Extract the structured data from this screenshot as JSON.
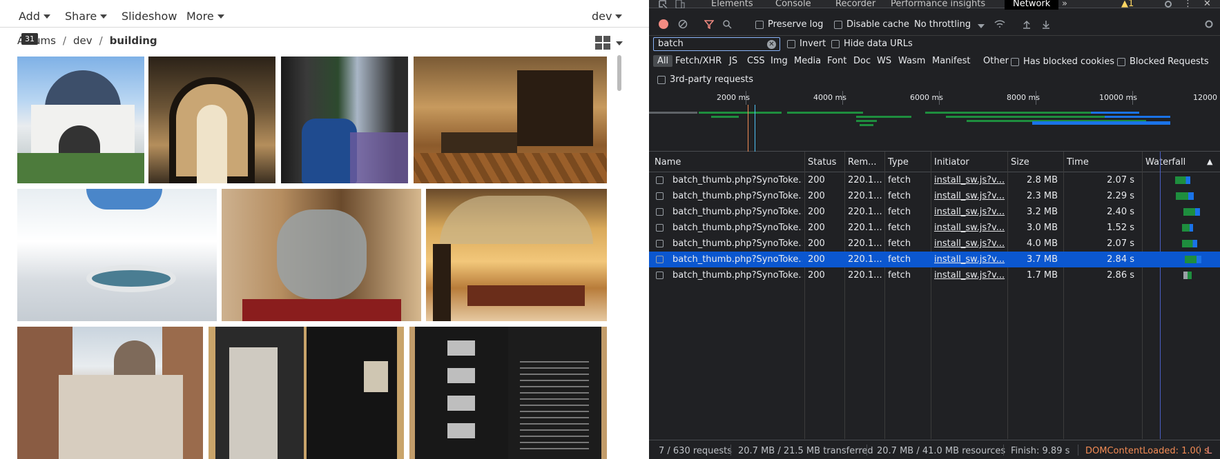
{
  "gallery": {
    "menus": [
      "Add",
      "Share",
      "Slideshow",
      "More"
    ],
    "user": "dev",
    "breadcrumb": [
      "Albums",
      "dev",
      "building"
    ],
    "tooltip": "31"
  },
  "devtools": {
    "tabs": [
      "Elements",
      "Console",
      "Recorder",
      "Performance insights",
      "Network"
    ],
    "active_tab": "Network",
    "warning_count": "1",
    "toolbar": {
      "preserve_log": "Preserve log",
      "disable_cache": "Disable cache",
      "throttling": "No throttling"
    },
    "filter": {
      "value": "batch",
      "invert": "Invert",
      "hide_data_urls": "Hide data URLs"
    },
    "types": [
      "All",
      "Fetch/XHR",
      "JS",
      "CSS",
      "Img",
      "Media",
      "Font",
      "Doc",
      "WS",
      "Wasm",
      "Manifest",
      "Other"
    ],
    "has_blocked_cookies": "Has blocked cookies",
    "blocked_requests": "Blocked Requests",
    "third_party": "3rd-party requests",
    "overview_ticks": [
      "2000 ms",
      "4000 ms",
      "6000 ms",
      "8000 ms",
      "10000 ms",
      "12000"
    ],
    "columns": [
      "Name",
      "Status",
      "Rem...",
      "Type",
      "Initiator",
      "Size",
      "Time",
      "Waterfall"
    ],
    "rows": [
      {
        "name": "batch_thumb.php?SynoToke...",
        "status": "200",
        "remote": "220.1...",
        "type": "fetch",
        "initiator": "install_sw.js?v...",
        "size": "2.8 MB",
        "time": "2.07 s"
      },
      {
        "name": "batch_thumb.php?SynoToke...",
        "status": "200",
        "remote": "220.1...",
        "type": "fetch",
        "initiator": "install_sw.js?v...",
        "size": "2.3 MB",
        "time": "2.29 s"
      },
      {
        "name": "batch_thumb.php?SynoToke...",
        "status": "200",
        "remote": "220.1...",
        "type": "fetch",
        "initiator": "install_sw.js?v...",
        "size": "3.2 MB",
        "time": "2.40 s"
      },
      {
        "name": "batch_thumb.php?SynoToke...",
        "status": "200",
        "remote": "220.1...",
        "type": "fetch",
        "initiator": "install_sw.js?v...",
        "size": "3.0 MB",
        "time": "1.52 s"
      },
      {
        "name": "batch_thumb.php?SynoToke...",
        "status": "200",
        "remote": "220.1...",
        "type": "fetch",
        "initiator": "install_sw.js?v...",
        "size": "4.0 MB",
        "time": "2.07 s"
      },
      {
        "name": "batch_thumb.php?SynoToke...",
        "status": "200",
        "remote": "220.1...",
        "type": "fetch",
        "initiator": "install_sw.js?v...",
        "size": "3.7 MB",
        "time": "2.84 s"
      },
      {
        "name": "batch_thumb.php?SynoToke...",
        "status": "200",
        "remote": "220.1...",
        "type": "fetch",
        "initiator": "install_sw.js?v...",
        "size": "1.7 MB",
        "time": "2.86 s"
      }
    ],
    "status": {
      "requests": "7 / 630 requests",
      "transferred": "20.7 MB / 21.5 MB transferred",
      "resources": "20.7 MB / 41.0 MB resources",
      "finish": "Finish: 9.89 s",
      "dcl": "DOMContentLoaded: 1.00 s",
      "load": "L"
    },
    "colors": {
      "accent": "#8ab4f8",
      "selected": "#0b57d0",
      "dcl": "#f28b54",
      "green": "#1e8e3e"
    }
  }
}
